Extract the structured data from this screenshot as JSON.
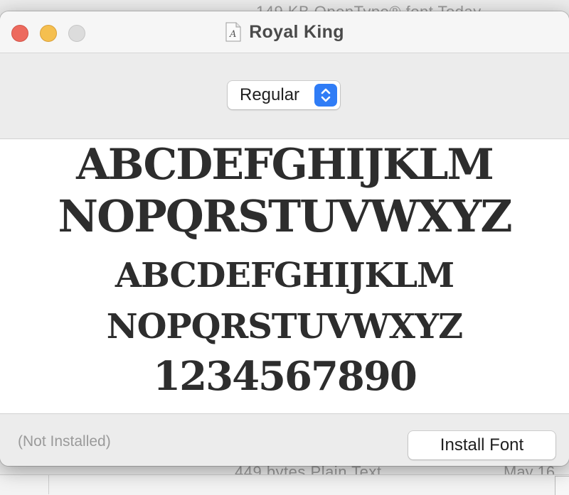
{
  "window": {
    "title": "Royal King",
    "file_icon": "font-file-icon",
    "file_icon_letter": "A"
  },
  "background": {
    "top_text": "149 KB    OpenType® font    Today",
    "bottom_text": "449 bytes    Plain Text",
    "bottom_date": "May 16"
  },
  "toolbar": {
    "style_select": {
      "selected": "Regular",
      "icon": "up-down-chevron-icon"
    }
  },
  "preview": {
    "lines": [
      "ABCDEFGHIJKLM",
      "NOPQRSTUVWXYZ",
      "ABCDEFGHIJKLM",
      "NOPQRSTUVWXYZ",
      "1234567890"
    ]
  },
  "footer": {
    "status": "(Not Installed)",
    "install_label": "Install Font"
  },
  "colors": {
    "close": "#ed6a5e",
    "minimize": "#f5bf4f",
    "zoom_inactive": "#dcdcdc",
    "accent": "#2f7cf6",
    "sample_text": "#2d2d2d"
  }
}
